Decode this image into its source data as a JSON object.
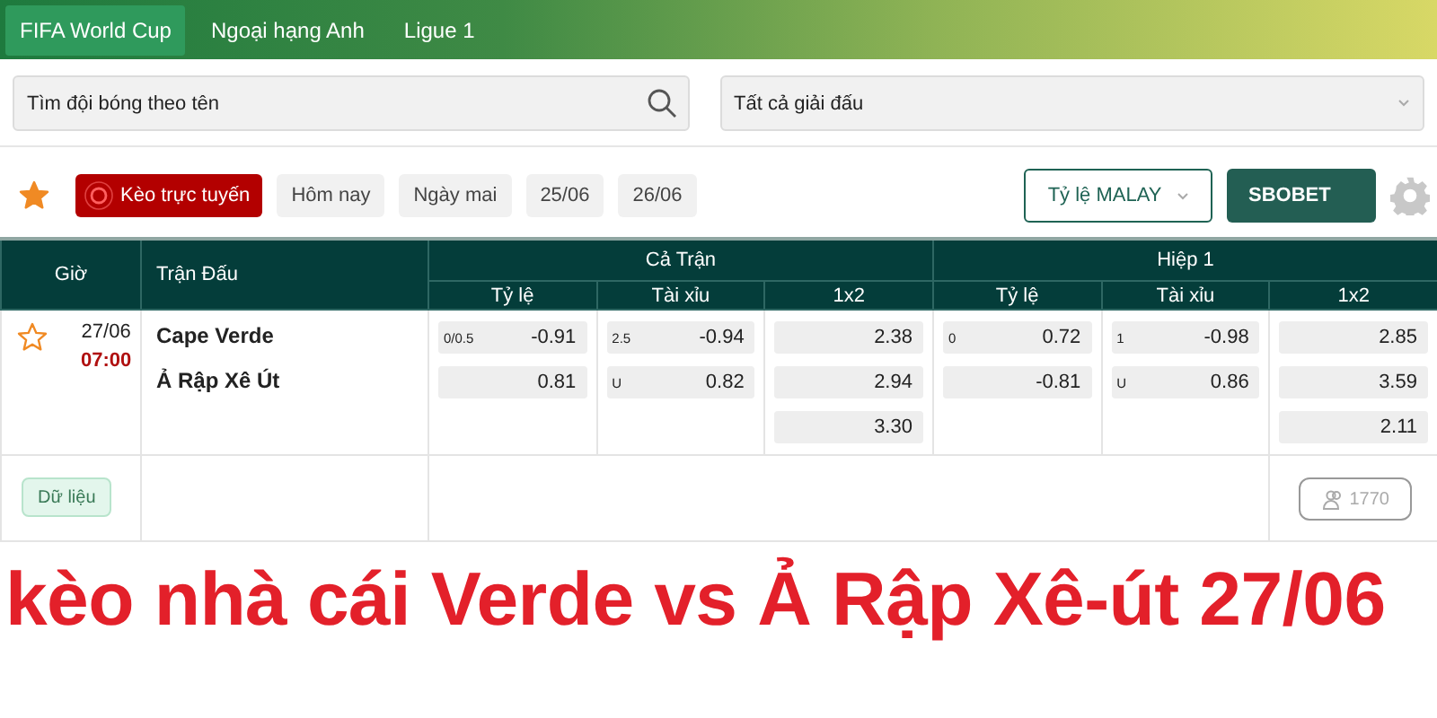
{
  "league_tabs": [
    {
      "label": "FIFA World Cup",
      "selected": true
    },
    {
      "label": "Ngoại hạng Anh",
      "selected": false
    },
    {
      "label": "Ligue 1",
      "selected": false
    }
  ],
  "search": {
    "placeholder": "Tìm đội bóng theo tên"
  },
  "league_select": {
    "value": "Tất cả giải đấu"
  },
  "filters": {
    "live_label": "Kèo trực tuyến",
    "dates": [
      {
        "label": "Hôm nay",
        "selected": false
      },
      {
        "label": "Ngày mai",
        "selected": false
      },
      {
        "label": "25/06",
        "selected": false
      },
      {
        "label": "26/06",
        "selected": false
      }
    ],
    "odds_format": "Tỷ lệ MALAY",
    "bookmaker": "SBOBET"
  },
  "table": {
    "columns": [
      "Giờ",
      "Trận Đấu"
    ],
    "groups": [
      {
        "title": "Cả Trận",
        "columns": [
          "Tỷ lệ",
          "Tài xỉu",
          "1x2"
        ]
      },
      {
        "title": "Hiệp 1",
        "columns": [
          "Tỷ lệ",
          "Tài xỉu",
          "1x2"
        ]
      }
    ],
    "match": {
      "favorite": false,
      "date": "27/06",
      "time": "07:00",
      "home": "Cape Verde",
      "away": "Ả Rập Xê Út",
      "odds": [
        [
          {
            "line": "0/0.5",
            "value": "-0.91"
          },
          {
            "value": "0.81"
          }
        ],
        [
          {
            "line": "2.5",
            "value": "-0.94"
          },
          {
            "line": "U",
            "value": "0.82"
          }
        ],
        [
          {
            "value": "2.38"
          },
          {
            "value": "2.94"
          },
          {
            "value": "3.30"
          }
        ],
        [
          {
            "line": "0",
            "value": "0.72"
          },
          {
            "value": "-0.81"
          }
        ],
        [
          {
            "line": "1",
            "value": "-0.98"
          },
          {
            "line": "U",
            "value": "0.86"
          }
        ],
        [
          {
            "value": "2.85"
          },
          {
            "value": "3.59"
          },
          {
            "value": "2.11"
          }
        ]
      ],
      "data_button": "Dữ liệu",
      "followers": "1770"
    }
  },
  "caption": "kèo nhà cái Verde vs Ả Rập Xê-út 27/06"
}
